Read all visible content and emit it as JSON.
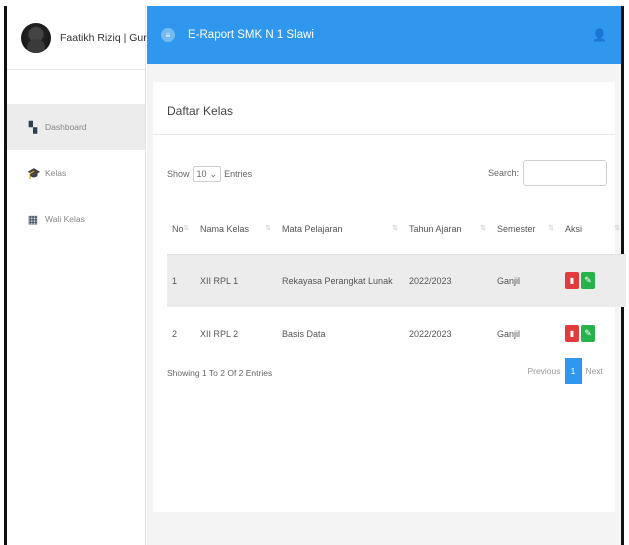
{
  "brand": {
    "user_label": "Faatikh Riziq | Guru"
  },
  "sidebar": {
    "items": [
      {
        "label": "Dashboard",
        "icon": "dashboard-icon",
        "glyph": "▚"
      },
      {
        "label": "Kelas",
        "icon": "graduation-cap-icon",
        "glyph": "🎓"
      },
      {
        "label": "Wali Kelas",
        "icon": "users-icon",
        "glyph": "▦"
      }
    ]
  },
  "header": {
    "title": "E-Raport SMK N 1 Slawi",
    "menu_glyph": "≡",
    "user_glyph": "👤"
  },
  "main": {
    "title": "Daftar Kelas",
    "length": {
      "show": "Show",
      "value": "10",
      "entries": "Entries"
    },
    "search": {
      "label": "Search:",
      "value": ""
    },
    "table": {
      "headers": [
        "No",
        "Nama Kelas",
        "Mata Pelajaran",
        "Tahun Ajaran",
        "Semester",
        "Aksi"
      ],
      "rows": [
        [
          "1",
          "XII RPL 1",
          "Rekayasa Perangkat Lunak",
          "2022/2023",
          "Ganjil"
        ],
        [
          "2",
          "XII RPL 2",
          "Basis Data",
          "2022/2023",
          "Ganjil"
        ]
      ]
    },
    "info": "Showing 1 To 2 Of 2 Entries",
    "pager": {
      "previous": "Previous",
      "current": "1",
      "next": "Next"
    }
  },
  "colors": {
    "header": "#2f97ee",
    "delete": "#e23b3b",
    "edit": "#27b34a"
  }
}
